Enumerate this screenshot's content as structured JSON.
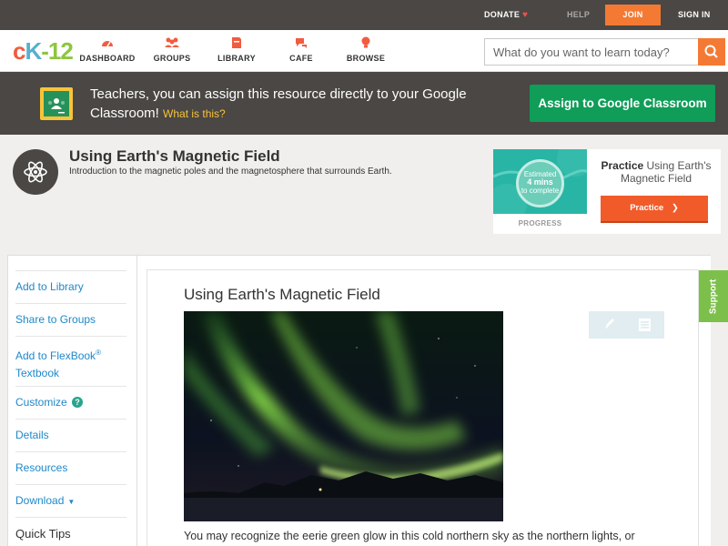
{
  "topbar": {
    "donate": "DONATE",
    "help": "HELP",
    "join": "JOIN",
    "signin": "SIGN IN"
  },
  "nav": {
    "logo": {
      "c": "c",
      "k": "K",
      "dash": "-",
      "num": "12"
    },
    "items": [
      {
        "label": "DASHBOARD",
        "icon": "dashboard-icon"
      },
      {
        "label": "GROUPS",
        "icon": "groups-icon"
      },
      {
        "label": "LIBRARY",
        "icon": "library-icon"
      },
      {
        "label": "CAFE",
        "icon": "cafe-icon"
      },
      {
        "label": "BROWSE",
        "icon": "browse-icon"
      }
    ],
    "search_placeholder": "What do you want to learn today?"
  },
  "classroom": {
    "text": "Teachers, you can assign this resource directly to your Google Classroom!",
    "what": "What is this?",
    "button": "Assign to Google Classroom"
  },
  "header": {
    "title": "Using Earth's Magnetic Field",
    "subtitle": "Introduction to the magnetic poles and the magnetosphere that surrounds Earth."
  },
  "practice": {
    "badge_line1": "Estimated",
    "badge_num": "4 mins",
    "badge_line3": "to complete",
    "progress": "PROGRESS",
    "title_bold": "Practice",
    "title_rest": "Using Earth's Magnetic Field",
    "button": "Practice"
  },
  "sidebar": {
    "add_library": "Add to Library",
    "share_groups": "Share to Groups",
    "add_flexbook": "Add to FlexBook",
    "reg": "®",
    "textbook": "Textbook",
    "customize": "Customize",
    "customize_help": "?",
    "details": "Details",
    "resources": "Resources",
    "download": "Download",
    "quick_tips": "Quick Tips"
  },
  "content": {
    "title": "Using Earth's Magnetic Field",
    "body": "You may recognize the eerie green glow in this cold northern sky as the northern lights, or"
  },
  "support": "Support",
  "colors": {
    "dark": "#4a4744",
    "orange": "#f47a34",
    "google_green": "#0f9d58",
    "link_blue": "#1e88c9",
    "support_green": "#7cc04b"
  }
}
